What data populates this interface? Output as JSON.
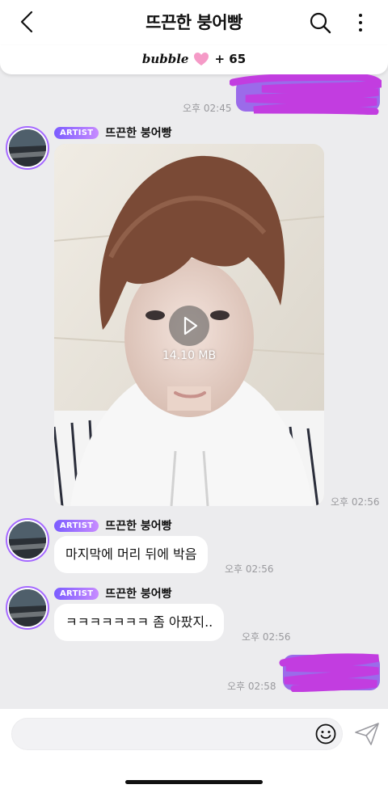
{
  "header": {
    "title": "뜨끈한 붕어빵",
    "back_icon": "chevron-left-icon",
    "search_icon": "search-icon",
    "more_icon": "vertical-ellipsis-icon"
  },
  "bubble_bar": {
    "logo": "bubble",
    "heart_icon": "pink-heart-icon",
    "count": "+ 65"
  },
  "colors": {
    "accent": "#a569ff",
    "scribble": "#c23de0",
    "bubble_bg": "#ffffff",
    "chat_bg": "#ececee"
  },
  "messages": [
    {
      "type": "sent",
      "text": "",
      "time": "오후 02:45",
      "note": "redacted"
    },
    {
      "type": "received",
      "badge": "ARTIST",
      "sender": "뜨끈한 붕어빵",
      "kind": "video",
      "size": "14.10 MB",
      "time": "오후 02:56"
    },
    {
      "type": "received",
      "badge": "ARTIST",
      "sender": "뜨끈한 붕어빵",
      "kind": "text",
      "text": "마지막에 머리 뒤에 박음",
      "time": "오후 02:56"
    },
    {
      "type": "received",
      "badge": "ARTIST",
      "sender": "뜨끈한 붕어빵",
      "kind": "text",
      "text": "ㅋㅋㅋㅋㅋㅋㅋ 좀 아팠지..",
      "time": "오후 02:56"
    },
    {
      "type": "sent",
      "text": "",
      "time": "오후 02:58"
    }
  ],
  "composer": {
    "placeholder": "",
    "emoji_icon": "smiley-icon",
    "send_icon": "paper-plane-icon"
  }
}
